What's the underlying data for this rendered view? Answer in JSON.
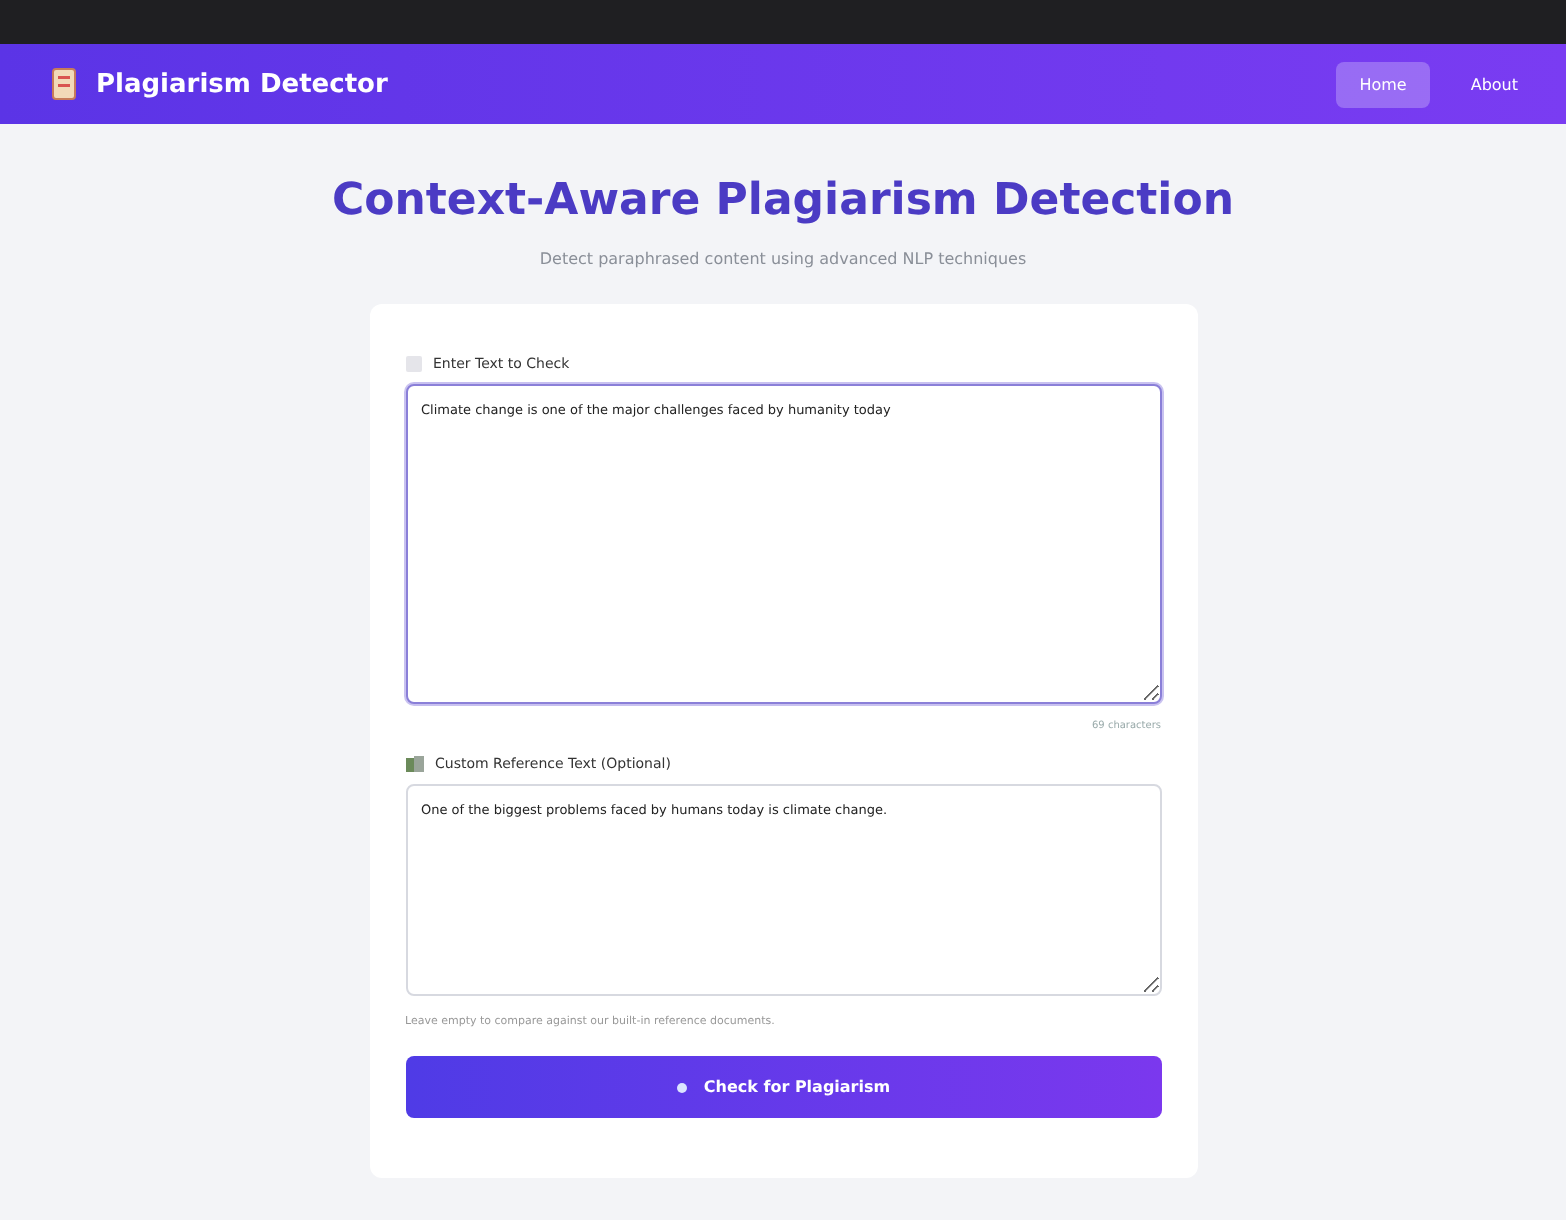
{
  "header": {
    "title": "Plagiarism Detector",
    "nav": [
      {
        "label": "Home",
        "selected": true
      },
      {
        "label": "About",
        "selected": false
      }
    ]
  },
  "hero": {
    "title": "Context-Aware Plagiarism Detection",
    "subtitle": "Detect paraphrased content using advanced NLP techniques"
  },
  "form": {
    "input": {
      "label": "Enter Text to Check",
      "value": "Climate change is one of the major challenges faced by humanity today",
      "focused": true,
      "count": "69 characters"
    },
    "reference": {
      "label": "Custom Reference Text (Optional)",
      "value": "One of the biggest problems faced by humans today is climate change.",
      "hint": "Leave empty to compare against our built-in reference documents."
    },
    "submit": {
      "label": "Check for Plagiarism"
    }
  }
}
